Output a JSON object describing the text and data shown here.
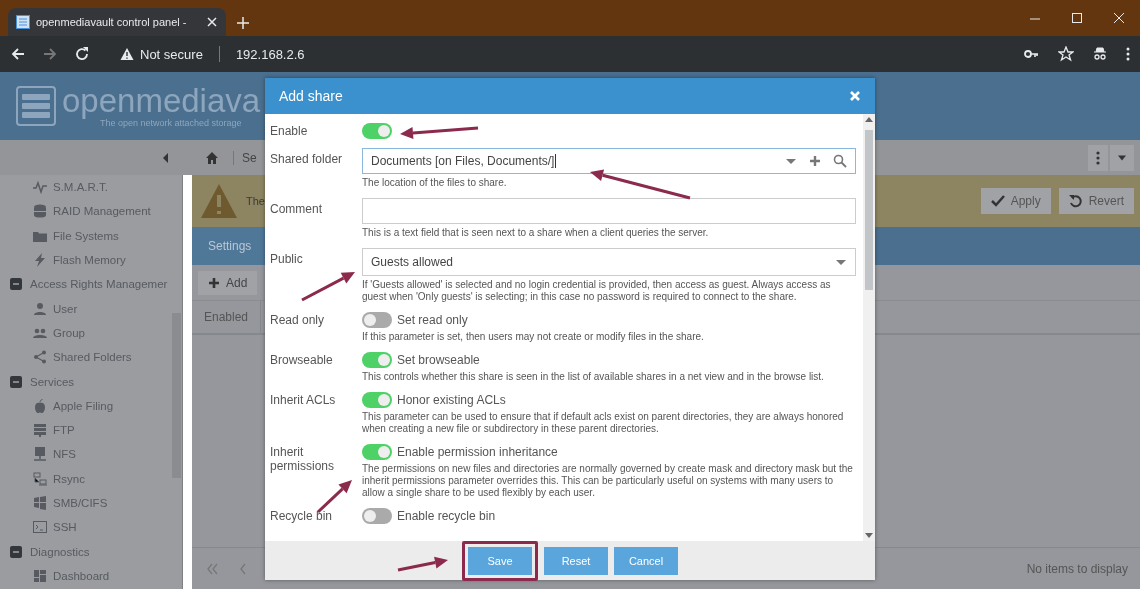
{
  "browser": {
    "tab_title": "openmediavault control panel - ",
    "security": "Not secure",
    "url": "192.168.2.6"
  },
  "app": {
    "logo_text": "openmediava",
    "tagline": "The open network attached storage",
    "breadcrumb": "Se"
  },
  "sidebar": {
    "continued_items": [
      {
        "label": "S.M.A.R.T."
      },
      {
        "label": "RAID Management"
      },
      {
        "label": "File Systems"
      },
      {
        "label": "Flash Memory"
      }
    ],
    "groups": [
      {
        "label": "Access Rights Managemer",
        "expanded": true,
        "children": [
          {
            "label": "User"
          },
          {
            "label": "Group"
          },
          {
            "label": "Shared Folders"
          }
        ]
      },
      {
        "label": "Services",
        "expanded": true,
        "children": [
          {
            "label": "Apple Filing"
          },
          {
            "label": "FTP"
          },
          {
            "label": "NFS"
          },
          {
            "label": "Rsync"
          },
          {
            "label": "SMB/CIFS"
          },
          {
            "label": "SSH"
          }
        ]
      },
      {
        "label": "Diagnostics",
        "expanded": true,
        "children": [
          {
            "label": "Dashboard"
          }
        ]
      }
    ]
  },
  "banner": {
    "text": "The",
    "buttons": [
      "Apply",
      "Revert"
    ]
  },
  "tabs": [
    {
      "label": "Settings",
      "selected": true
    }
  ],
  "toolbar": {
    "add": "Add"
  },
  "grid": {
    "columns": [
      "Enabled"
    ],
    "empty_text": "No items to display"
  },
  "dialog": {
    "title": "Add share",
    "fields": [
      {
        "kind": "switch",
        "label": "Enable",
        "on": true
      },
      {
        "kind": "combo",
        "label": "Shared folder",
        "value": "Documents [on Files, Documents/]",
        "hint": "The location of the files to share."
      },
      {
        "kind": "text",
        "label": "Comment",
        "hint": "This is a text field that is seen next to a share when a client queries the server."
      },
      {
        "kind": "select",
        "label": "Public",
        "value": "Guests allowed",
        "hint": "If 'Guests allowed' is selected and no login credential is provided, then access as guest. Always access as guest when 'Only guests' is selecting; in this case no password is required to connect to the share."
      },
      {
        "kind": "switch",
        "label": "Read only",
        "on": false,
        "text": "Set read only",
        "hint": "If this parameter is set, then users may not create or modify files in the share."
      },
      {
        "kind": "switch",
        "label": "Browseable",
        "on": true,
        "text": "Set browseable",
        "hint": "This controls whether this share is seen in the list of available shares in a net view and in the browse list."
      },
      {
        "kind": "switch",
        "label": "Inherit ACLs",
        "on": true,
        "text": "Honor existing ACLs",
        "hint": "This parameter can be used to ensure that if default acls exist on parent directories, they are always honored when creating a new file or subdirectory in these parent directories."
      },
      {
        "kind": "switch",
        "label": "Inherit permissions",
        "on": true,
        "text": "Enable permission inheritance",
        "hint": "The permissions on new files and directories are normally governed by create mask and directory mask but the inherit permissions parameter overrides this. This can be particularly useful on systems with many users to allow a single share to be used flexibly by each user."
      },
      {
        "kind": "switch",
        "label": "Recycle bin",
        "on": false,
        "text": "Enable recycle bin"
      }
    ],
    "buttons": [
      {
        "label": "Save",
        "highlighted": true
      },
      {
        "label": "Reset",
        "highlighted": false
      },
      {
        "label": "Cancel",
        "highlighted": false
      }
    ]
  }
}
